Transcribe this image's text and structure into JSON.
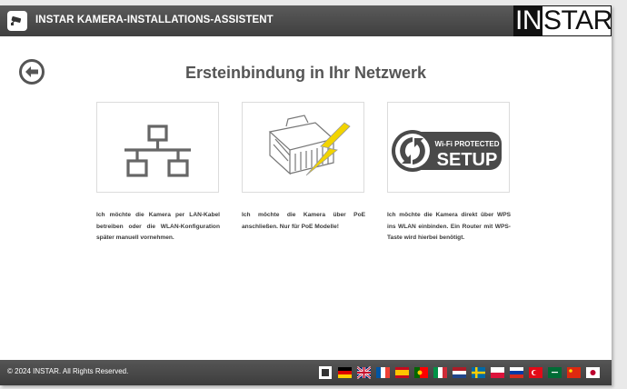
{
  "header": {
    "title": "INSTAR KAMERA-INSTALLATIONS-ASSISTENT"
  },
  "logo": {
    "part1": "IN",
    "part2": "STAR"
  },
  "main": {
    "title": "Ersteinbindung in Ihr Netzwerk",
    "options": [
      {
        "icon": "network-lan-icon",
        "text": "Ich möchte die Kamera per LAN-Kabel betreiben oder die WLAN-Konfiguration später manuell vornehmen."
      },
      {
        "icon": "poe-plug-icon",
        "text": "Ich möchte die Kamera über PoE anschließen. Nur für PoE Modelle!"
      },
      {
        "icon": "wps-setup-icon",
        "text": "Ich möchte die Kamera direkt über WPS ins WLAN einbinden. Ein Router mit WPS-Taste wird hierbei benötigt.",
        "badge_line1": "Wi-Fi PROTECTED",
        "badge_line2": "SETUP"
      }
    ]
  },
  "footer": {
    "copyright": "© 2024 INSTAR. All Rights Reserved.",
    "languages": [
      "Support",
      "Deutsch",
      "English",
      "Français",
      "Español",
      "Português",
      "Italiano",
      "Nederlands",
      "Svenska",
      "Polski",
      "Русский",
      "Türkçe",
      "عربى",
      "中文",
      "日本語"
    ]
  },
  "colors": {
    "topbar": "#4a4a4a",
    "title": "#555555",
    "accent_yellow": "#f2d400"
  }
}
